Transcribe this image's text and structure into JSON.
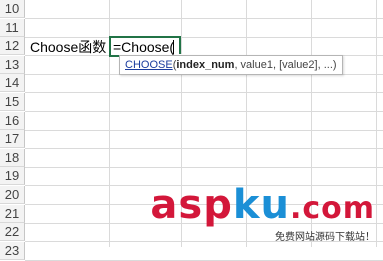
{
  "rows": [
    "10",
    "11",
    "12",
    "13",
    "14",
    "15",
    "16",
    "17",
    "18",
    "19",
    "20",
    "21",
    "22",
    "23"
  ],
  "cell_a12": "Choose函数",
  "cell_b12_formula": "=Choose(",
  "tooltip": {
    "function_name": "CHOOSE",
    "open_paren": "(",
    "arg1": "index_num",
    "rest": ", value1, [value2], ...)"
  },
  "watermark": {
    "asp": "asp",
    "ku": "ku",
    "dotcom": ".com",
    "subtitle": "免费网站源码下载站！"
  },
  "colors": {
    "active_cell_border": "#217346",
    "function_link": "#1a3c9e",
    "watermark_red": "#d3173a",
    "watermark_blue": "#1b8fd6"
  }
}
